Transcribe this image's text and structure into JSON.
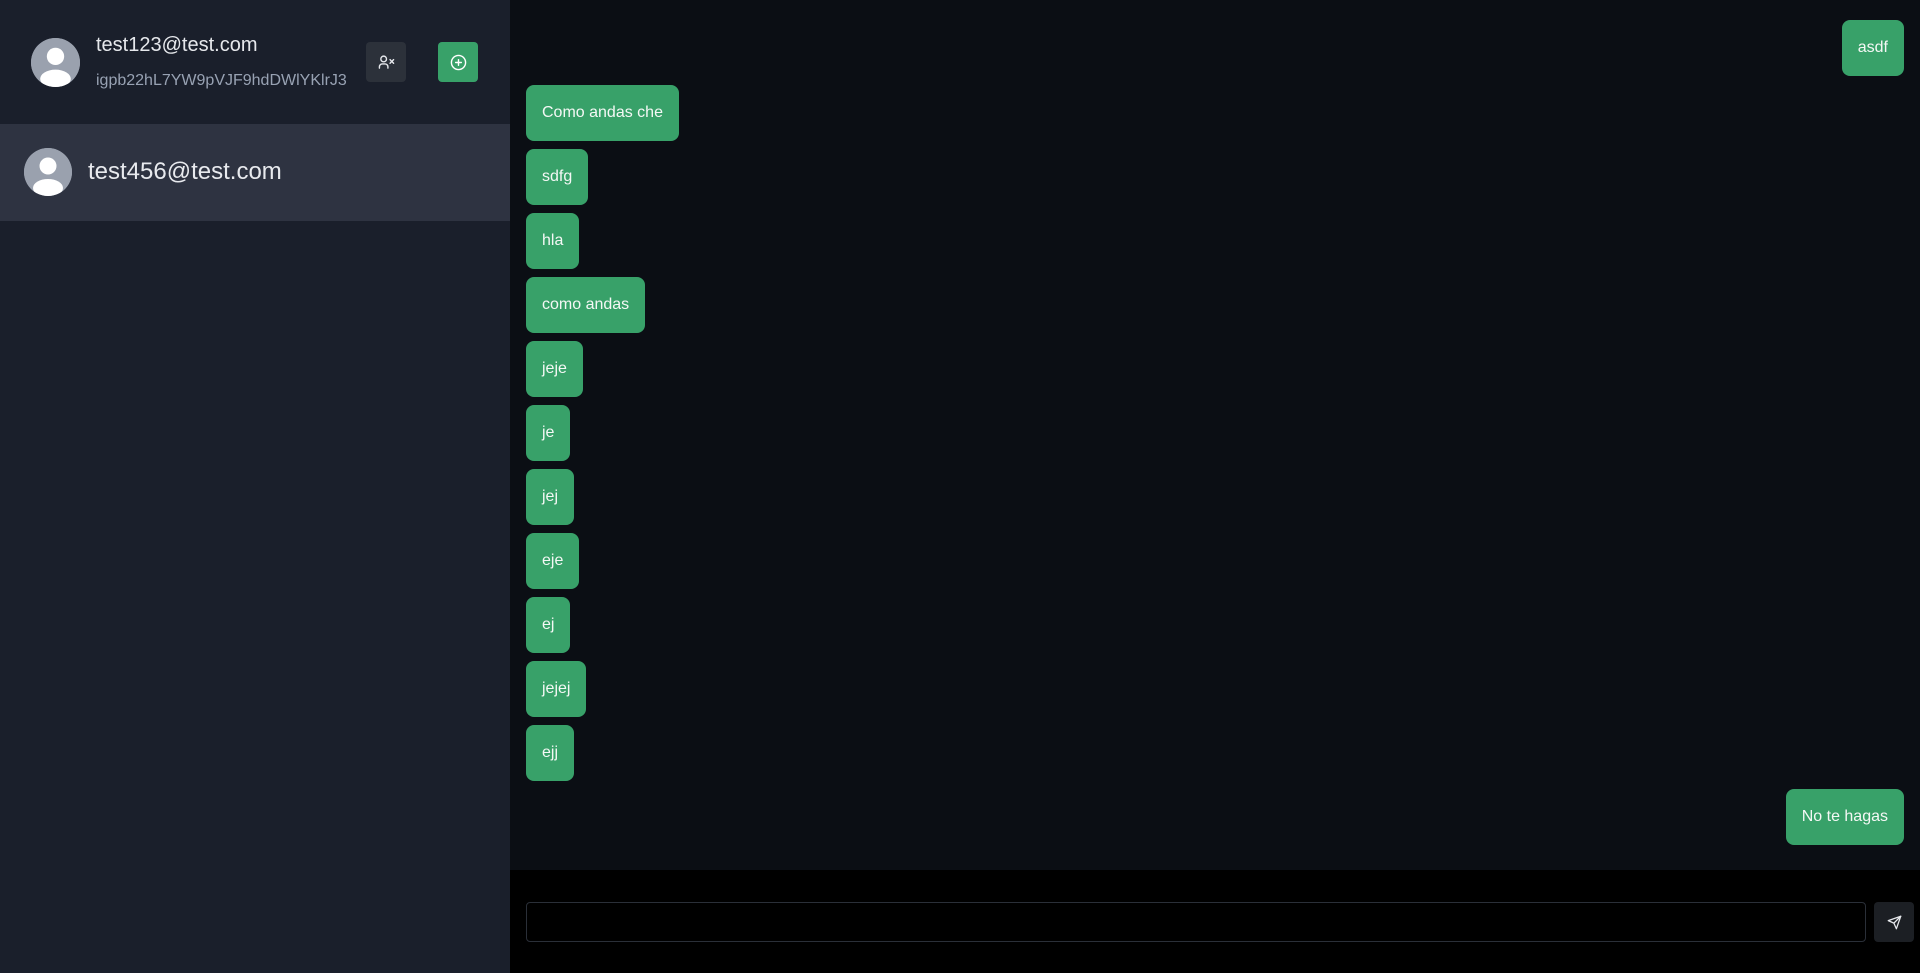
{
  "colors": {
    "sidebar_bg": "#1a1f2b",
    "selected_contact_bg": "#2e3341",
    "chat_bg": "#0b0e14",
    "composer_bg": "#000000",
    "bubble_accent": "#38a169"
  },
  "profile": {
    "email": "test123@test.com",
    "user_id": "igpb22hL7YW9pVJF9hdDWlYKlrJ3",
    "avatar_icon": "user-avatar-icon",
    "remove_contact_icon": "user-remove-icon",
    "add_contact_icon": "plus-circle-icon"
  },
  "contacts": [
    {
      "name": "test456@test.com",
      "selected": true,
      "avatar_icon": "user-avatar-icon"
    }
  ],
  "messages": [
    {
      "text": "asdf",
      "direction": "outgoing"
    },
    {
      "text": "Como andas che",
      "direction": "incoming"
    },
    {
      "text": "sdfg",
      "direction": "incoming"
    },
    {
      "text": "hla",
      "direction": "incoming"
    },
    {
      "text": "como andas",
      "direction": "incoming"
    },
    {
      "text": "jeje",
      "direction": "incoming"
    },
    {
      "text": "je",
      "direction": "incoming"
    },
    {
      "text": "jej",
      "direction": "incoming"
    },
    {
      "text": "eje",
      "direction": "incoming"
    },
    {
      "text": "ej",
      "direction": "incoming"
    },
    {
      "text": "jejej",
      "direction": "incoming"
    },
    {
      "text": "ejj",
      "direction": "incoming"
    },
    {
      "text": "No te hagas",
      "direction": "outgoing"
    }
  ],
  "composer": {
    "value": "",
    "placeholder": "",
    "send_icon": "send-icon"
  }
}
